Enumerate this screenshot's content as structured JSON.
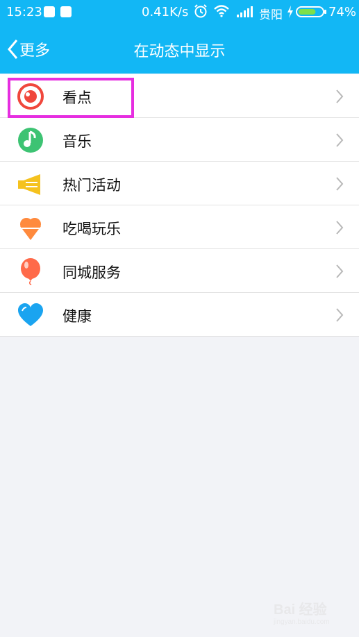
{
  "status_bar": {
    "time": "15:23",
    "speed": "0.41K/s",
    "carrier": "贵阳",
    "battery_percent": "74%",
    "battery_level": 0.74
  },
  "nav": {
    "back_label": "更多",
    "title": "在动态中显示"
  },
  "items": [
    {
      "label": "看点",
      "icon": "eye-icon",
      "color": "#f0473c"
    },
    {
      "label": "音乐",
      "icon": "music-note-icon",
      "color": "#3dc373"
    },
    {
      "label": "热门活动",
      "icon": "megaphone-icon",
      "color": "#f5c21e"
    },
    {
      "label": "吃喝玩乐",
      "icon": "ice-cream-icon",
      "color": "#ff8a3d"
    },
    {
      "label": "同城服务",
      "icon": "balloon-icon",
      "color": "#ff6a4a"
    },
    {
      "label": "健康",
      "icon": "heart-icon",
      "color": "#1aa4f0"
    }
  ],
  "watermark": {
    "text": "Bai 经验",
    "subtext": "jingyan.baidu.com"
  },
  "colors": {
    "accent": "#12b7f5",
    "highlight": "#e62ee0"
  }
}
